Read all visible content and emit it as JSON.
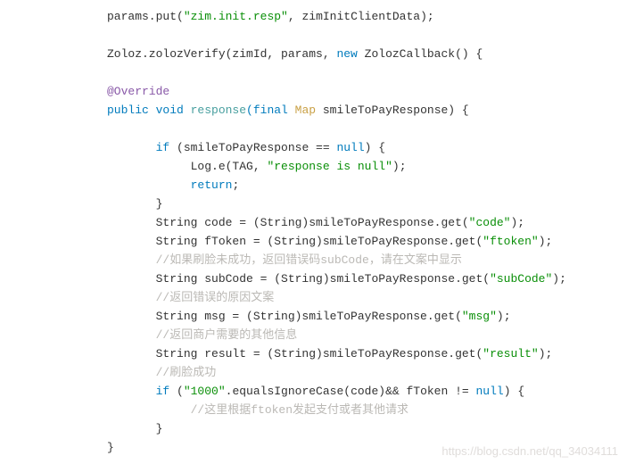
{
  "code": {
    "line1_method": "params.put(",
    "line1_str": "\"zim.init.resp\"",
    "line1_end": ", zimInitClientData);",
    "line3_a": "Zoloz.zolozVerify(zimId, params, ",
    "line3_kw": "new",
    "line3_b": " ZolozCallback() {",
    "line5_override": "@Override",
    "line6_kw1": "public",
    "line6_kw2": " void",
    "line6_method": " response",
    "line6_kw3": "(final",
    "line6_type": " Map",
    "line6_end": " smileToPayResponse) {",
    "line8_a": "if",
    "line8_b": " (smileToPayResponse == ",
    "line8_c": "null",
    "line8_d": ") {",
    "line9_a": "Log.e(TAG, ",
    "line9_str": "\"response is null\"",
    "line9_b": ");",
    "line10_a": "return",
    "line10_b": ";",
    "line11": "}",
    "line12_a": "String code = (String)smileToPayResponse.get(",
    "line12_str": "\"code\"",
    "line12_b": ");",
    "line13_a": "String fToken = (String)smileToPayResponse.get(",
    "line13_str": "\"ftoken\"",
    "line13_b": ");",
    "line14_comment": "//如果刷脸未成功，返回错误码subCode，请在文案中显示",
    "line15_a": "String subCode = (String)smileToPayResponse.get(",
    "line15_str": "\"subCode\"",
    "line15_b": ");",
    "line16_comment": "//返回错误的原因文案",
    "line17_a": "String msg = (String)smileToPayResponse.get(",
    "line17_str": "\"msg\"",
    "line17_b": ");",
    "line18_comment": "//返回商户需要的其他信息",
    "line19_a": "String result = (String)smileToPayResponse.get(",
    "line19_str": "\"result\"",
    "line19_b": ");",
    "line20_comment": "//刷脸成功",
    "line21_a": "if",
    "line21_b": " (",
    "line21_str": "\"1000\"",
    "line21_c": ".equalsIgnoreCase(code)&& fToken != ",
    "line21_d": "null",
    "line21_e": ") {",
    "line22_comment": "//这里根据ftoken发起支付或者其他请求",
    "line23": "}",
    "line24": "}"
  },
  "watermark": "https://blog.csdn.net/qq_34034111"
}
